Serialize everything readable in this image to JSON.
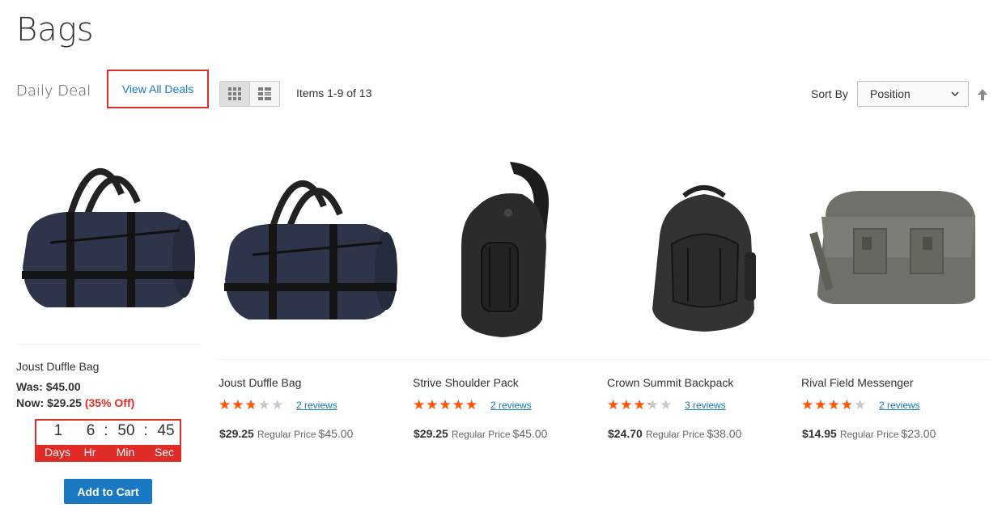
{
  "page": {
    "title": "Bags"
  },
  "toolbar": {
    "deal_label": "Daily Deal",
    "view_all_deals": "View All Deals",
    "amount": "Items 1-9 of 13",
    "sort_label": "Sort By",
    "sort_selected": "Position",
    "view_modes": [
      "grid-mode-icon",
      "list-mode-icon"
    ]
  },
  "deal": {
    "name": "Joust Duffle Bag",
    "was_label": "Was:",
    "was_price": "$45.00",
    "now_label": "Now:",
    "now_price": "$29.25",
    "off": "(35% Off)",
    "countdown": {
      "days": "1",
      "hours": "6",
      "minutes": "50",
      "seconds": "45",
      "labels": {
        "days": "Days",
        "hours": "Hr",
        "minutes": "Min",
        "seconds": "Sec"
      }
    },
    "add_to_cart": "Add to Cart"
  },
  "products": [
    {
      "name": "Joust Duffle Bag",
      "rating_percent": 50,
      "reviews": "2 reviews",
      "final_price": "$29.25",
      "regular_label": "Regular Price",
      "regular_price": "$45.00"
    },
    {
      "name": "Strive Shoulder Pack",
      "rating_percent": 90,
      "reviews": "2 reviews",
      "final_price": "$29.25",
      "regular_label": "Regular Price",
      "regular_price": "$45.00"
    },
    {
      "name": "Crown Summit Backpack",
      "rating_percent": 60,
      "reviews": "3 reviews",
      "final_price": "$24.70",
      "regular_label": "Regular Price",
      "regular_price": "$38.00"
    },
    {
      "name": "Rival Field Messenger",
      "rating_percent": 70,
      "reviews": "2 reviews",
      "final_price": "$14.95",
      "regular_label": "Regular Price",
      "regular_price": "$23.00"
    }
  ],
  "colors": {
    "accent": "#1979c3",
    "deal_red": "#e02b27",
    "star": "#ff5501",
    "star_empty": "#c7c7c7"
  }
}
